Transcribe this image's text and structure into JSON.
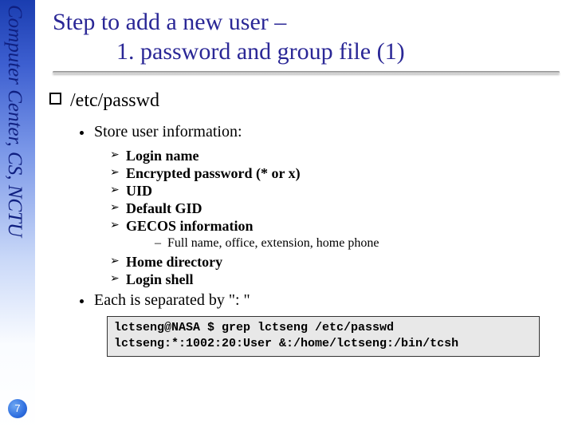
{
  "sidebar_text": "Computer Center, CS, NCTU",
  "title_line1": "Step to add a new user –",
  "title_line2": "1. password and group file (1)",
  "lvl1_heading": "/etc/passwd",
  "lvl2_item1": "Store user information:",
  "lvl3_items_a": [
    "Login name",
    "Encrypted password (* or x)",
    "UID",
    "Default GID",
    "GECOS information"
  ],
  "lvl4_item": "Full name, office, extension, home phone",
  "lvl3_items_b": [
    "Home directory",
    "Login shell"
  ],
  "lvl2_item2": "Each is separated by \": \"",
  "code_line1": "lctseng@NASA $ grep lctseng /etc/passwd",
  "code_line2": "lctseng:*:1002:20:User &:/home/lctseng:/bin/tcsh",
  "page_number": "7"
}
